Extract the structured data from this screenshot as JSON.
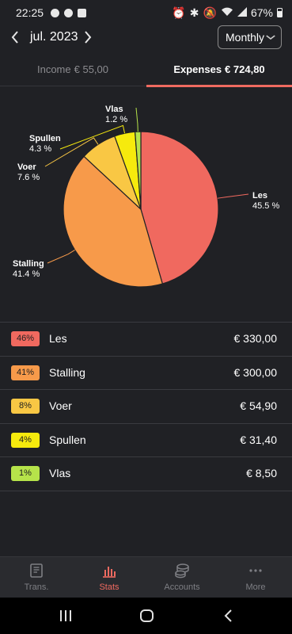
{
  "status_bar": {
    "time": "22:25",
    "battery": "67%"
  },
  "header": {
    "month": "jul. 2023",
    "period": "Monthly"
  },
  "tabs": [
    {
      "label": "Income",
      "amount": "€ 55,00"
    },
    {
      "label": "Expenses",
      "amount": "€ 724,80"
    }
  ],
  "colors": {
    "accent": "#f06a60",
    "les": "#f0695f",
    "stalling": "#f79a4a",
    "voer": "#f9c744",
    "spullen": "#f6ea0d",
    "vlas": "#b6e34a"
  },
  "chart_data": {
    "type": "pie",
    "slices": [
      {
        "name": "Les",
        "percent": 45.5,
        "label": "45.5 %",
        "color": "#f0695f"
      },
      {
        "name": "Stalling",
        "percent": 41.4,
        "label": "41.4 %",
        "color": "#f79a4a"
      },
      {
        "name": "Voer",
        "percent": 7.6,
        "label": "7.6 %",
        "color": "#f9c744"
      },
      {
        "name": "Spullen",
        "percent": 4.3,
        "label": "4.3 %",
        "color": "#f6ea0d"
      },
      {
        "name": "Vlas",
        "percent": 1.2,
        "label": "1.2 %",
        "color": "#b6e34a"
      }
    ]
  },
  "categories": [
    {
      "badge": "46%",
      "name": "Les",
      "amount": "€ 330,00",
      "color": "#f0695f"
    },
    {
      "badge": "41%",
      "name": "Stalling",
      "amount": "€ 300,00",
      "color": "#f79a4a"
    },
    {
      "badge": "8%",
      "name": "Voer",
      "amount": "€ 54,90",
      "color": "#f9c744"
    },
    {
      "badge": "4%",
      "name": "Spullen",
      "amount": "€ 31,40",
      "color": "#f6ea0d"
    },
    {
      "badge": "1%",
      "name": "Vlas",
      "amount": "€ 8,50",
      "color": "#b6e34a"
    }
  ],
  "bottom_nav": [
    {
      "label": "Trans.",
      "icon": "book-icon"
    },
    {
      "label": "Stats",
      "icon": "bar-chart-icon",
      "active": true
    },
    {
      "label": "Accounts",
      "icon": "coins-icon"
    },
    {
      "label": "More",
      "icon": "more-dots-icon"
    }
  ]
}
